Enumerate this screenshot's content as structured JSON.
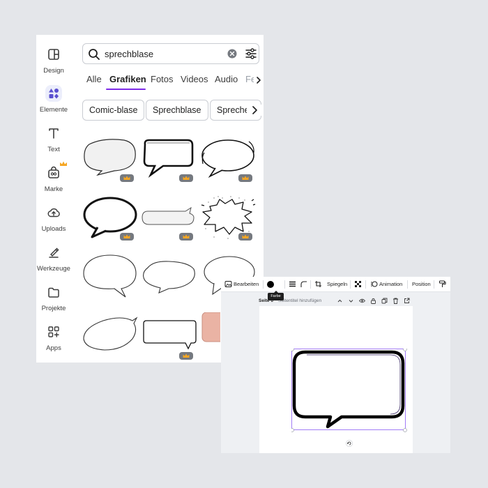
{
  "sidebar": {
    "items": [
      {
        "label": "Design",
        "icon": "layout-icon"
      },
      {
        "label": "Elemente",
        "icon": "shapes-icon",
        "active": true
      },
      {
        "label": "Text",
        "icon": "text-icon"
      },
      {
        "label": "Marke",
        "icon": "brand-icon",
        "premium": true
      },
      {
        "label": "Uploads",
        "icon": "cloud-upload-icon"
      },
      {
        "label": "Werkzeuge",
        "icon": "tools-icon"
      },
      {
        "label": "Projekte",
        "icon": "folder-icon"
      },
      {
        "label": "Apps",
        "icon": "apps-icon"
      }
    ]
  },
  "search": {
    "value": "sprechblase",
    "icons": [
      "search-icon",
      "clear-icon",
      "filter-icon"
    ]
  },
  "tabs": [
    "Alle",
    "Grafiken",
    "Fotos",
    "Videos",
    "Audio",
    "Fe"
  ],
  "active_tab": "Grafiken",
  "chips": [
    "Comic-blase",
    "Sprechblase",
    "Sprechen"
  ],
  "results": {
    "count": 12,
    "premium_badge_icon": "crown-icon"
  },
  "editor": {
    "toolbar": {
      "edit_label": "Bearbeiten",
      "color_tooltip": "Farbe",
      "flip_label": "Spiegeln",
      "animation_label": "Animation",
      "position_label": "Position"
    },
    "page": {
      "label": "Seite 6",
      "title_placeholder": "Seitentitel hinzufügen"
    }
  },
  "colors": {
    "accent": "#7d2ae8",
    "selection": "#8b5cf6",
    "crown_badge": "#75797f",
    "crown_gold": "#f5a623",
    "panel_bg": "#ffffff",
    "backdrop": "#e4e6ea"
  }
}
